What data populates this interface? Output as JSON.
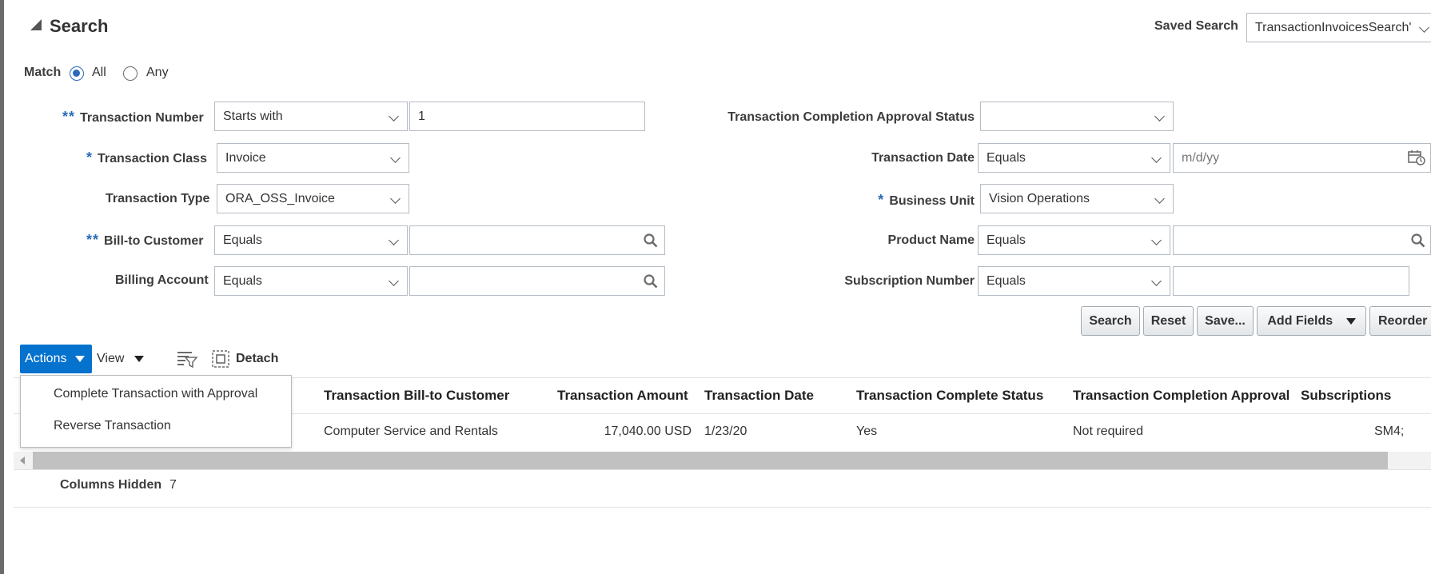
{
  "search": {
    "title": "Search",
    "saved_search_label": "Saved Search",
    "saved_search_value": "TransactionInvoicesSearch'",
    "match_label": "Match",
    "match_all": "All",
    "match_any": "Any",
    "match_selected": "All"
  },
  "fields": {
    "transaction_number": {
      "label": "Transaction Number",
      "required": "**",
      "operator": "Starts with",
      "value": "1"
    },
    "transaction_class": {
      "label": "Transaction Class",
      "required": "*",
      "value": "Invoice"
    },
    "transaction_type": {
      "label": "Transaction Type",
      "value": "ORA_OSS_Invoice"
    },
    "bill_to_customer": {
      "label": "Bill-to Customer",
      "required": "**",
      "operator": "Equals",
      "value": ""
    },
    "billing_account": {
      "label": "Billing Account",
      "operator": "Equals",
      "value": ""
    },
    "completion_approval_status": {
      "label": "Transaction Completion Approval Status",
      "value": ""
    },
    "transaction_date": {
      "label": "Transaction Date",
      "operator": "Equals",
      "placeholder": "m/d/yy"
    },
    "business_unit": {
      "label": "Business Unit",
      "required": "*",
      "value": "Vision Operations"
    },
    "product_name": {
      "label": "Product Name",
      "operator": "Equals",
      "value": ""
    },
    "subscription_number": {
      "label": "Subscription Number",
      "operator": "Equals",
      "value": ""
    }
  },
  "buttons": {
    "search": "Search",
    "reset": "Reset",
    "save": "Save...",
    "add_fields": "Add Fields",
    "reorder": "Reorder"
  },
  "toolbar": {
    "actions": "Actions",
    "view": "View",
    "detach": "Detach"
  },
  "actions_menu": {
    "items": [
      "Complete Transaction with Approval",
      "Reverse Transaction"
    ]
  },
  "table": {
    "headers": {
      "bill_to_customer": "Transaction Bill-to Customer",
      "amount": "Transaction Amount",
      "date": "Transaction Date",
      "complete_status": "Transaction Complete Status",
      "completion_approval": "Transaction Completion Approval",
      "subscriptions": "Subscriptions"
    },
    "rows": [
      {
        "bill_to_customer": "Computer Service and Rentals",
        "amount": "17,040.00",
        "currency": "USD",
        "date": "1/23/20",
        "complete_status": "Yes",
        "completion_approval": "Not required",
        "subscriptions": "SM4;"
      }
    ],
    "columns_hidden_label": "Columns Hidden",
    "columns_hidden_count": "7"
  },
  "colors": {
    "accent": "#0572ce",
    "required": "#2a6ab9"
  }
}
